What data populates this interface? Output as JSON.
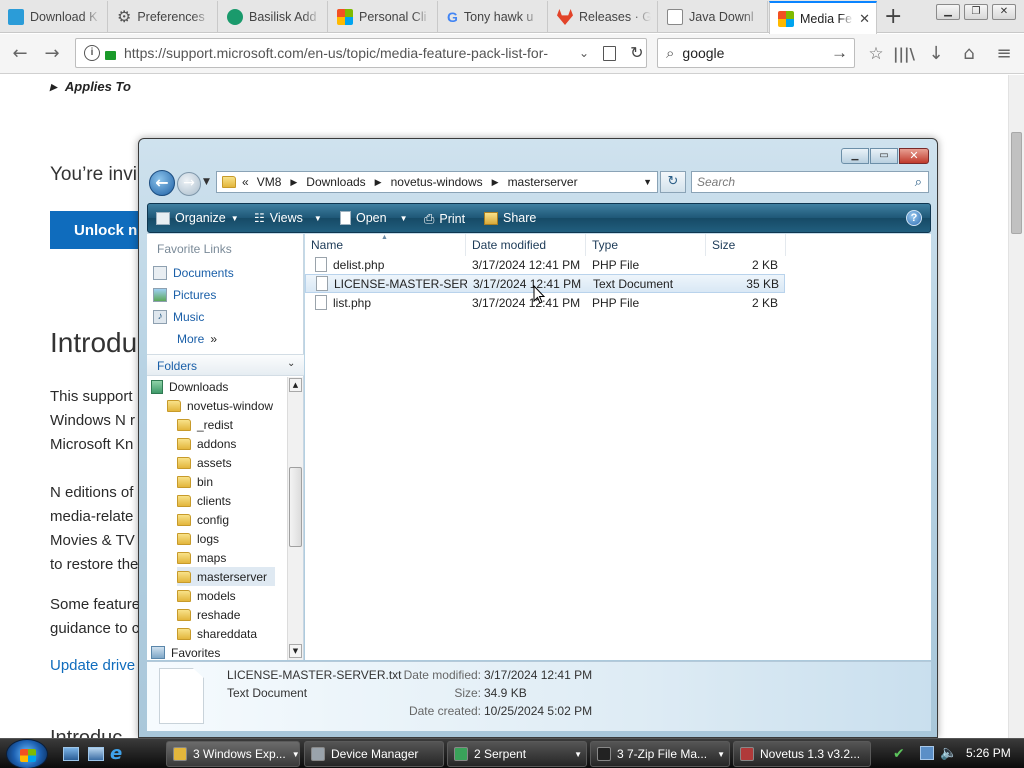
{
  "browser": {
    "tabs": [
      {
        "label": "Download K",
        "color": "#2b9cd8"
      },
      {
        "label": "Preferences",
        "color": "#555555"
      },
      {
        "label": "Basilisk Add",
        "color": "#1a9a6c"
      },
      {
        "label": "Personal Cli",
        "color": "#f25022"
      },
      {
        "label": "Tony hawk u",
        "color": "#4285f4"
      },
      {
        "label": "Releases · G",
        "color": "#e24329"
      },
      {
        "label": "Java Downl",
        "color": "#7a7a7a"
      },
      {
        "label": "Media Fe",
        "color": "#f25022"
      }
    ],
    "url": "https://support.microsoft.com/en-us/topic/media-feature-pack-list-for-",
    "url_domain": "support.microsoft.com",
    "search_value": "google"
  },
  "page": {
    "applies_to": "Applies To",
    "invite": "You’re invi",
    "unlock_button": "Unlock n",
    "heading": "Introdu",
    "para1": [
      "This support",
      "Windows N r",
      "Microsoft Kn"
    ],
    "para2": [
      "N editions of",
      "media-relate",
      "Movies & TV",
      "to restore the"
    ],
    "para3": [
      "Some feature",
      "guidance to c"
    ],
    "link": "Update drive",
    "bottom_cut": "Introduc"
  },
  "explorer": {
    "breadcrumb": [
      "VM8",
      "Downloads",
      "novetus-windows",
      "masterserver"
    ],
    "breadcrumb_prefix": "«",
    "search_placeholder": "Search",
    "toolbar": {
      "organize": "Organize",
      "views": "Views",
      "open": "Open",
      "print": "Print",
      "share": "Share"
    },
    "favorite_links_title": "Favorite Links",
    "favorite_links": [
      "Documents",
      "Pictures",
      "Music"
    ],
    "more": "More",
    "folders_title": "Folders",
    "tree": [
      {
        "label": "Downloads",
        "level": 0
      },
      {
        "label": "novetus-window",
        "level": 1
      },
      {
        "label": "_redist",
        "level": 2
      },
      {
        "label": "addons",
        "level": 2
      },
      {
        "label": "assets",
        "level": 2
      },
      {
        "label": "bin",
        "level": 2
      },
      {
        "label": "clients",
        "level": 2
      },
      {
        "label": "config",
        "level": 2
      },
      {
        "label": "logs",
        "level": 2
      },
      {
        "label": "maps",
        "level": 2
      },
      {
        "label": "masterserver",
        "level": 2
      },
      {
        "label": "models",
        "level": 2
      },
      {
        "label": "reshade",
        "level": 2
      },
      {
        "label": "shareddata",
        "level": 2
      },
      {
        "label": "Favorites",
        "level": 0
      }
    ],
    "columns": [
      "Name",
      "Date modified",
      "Type",
      "Size"
    ],
    "files": [
      {
        "name": "delist.php",
        "date": "3/17/2024 12:41 PM",
        "type": "PHP File",
        "size": "2 KB"
      },
      {
        "name": "LICENSE-MASTER-SER...",
        "date": "3/17/2024 12:41 PM",
        "type": "Text Document",
        "size": "35 KB"
      },
      {
        "name": "list.php",
        "date": "3/17/2024 12:41 PM",
        "type": "PHP File",
        "size": "2 KB"
      }
    ],
    "details": {
      "filename": "LICENSE-MASTER-SERVER.txt",
      "filetype": "Text Document",
      "date_modified_label": "Date modified:",
      "date_modified": "3/17/2024 12:41 PM",
      "size_label": "Size:",
      "size": "34.9 KB",
      "date_created_label": "Date created:",
      "date_created": "10/25/2024 5:02 PM"
    }
  },
  "taskbar": {
    "buttons": [
      "3 Windows Exp...",
      "Device Manager",
      "2 Serpent",
      "3 7-Zip File Ma...",
      "Novetus 1.3 v3.2..."
    ],
    "clock": "5:26 PM"
  }
}
